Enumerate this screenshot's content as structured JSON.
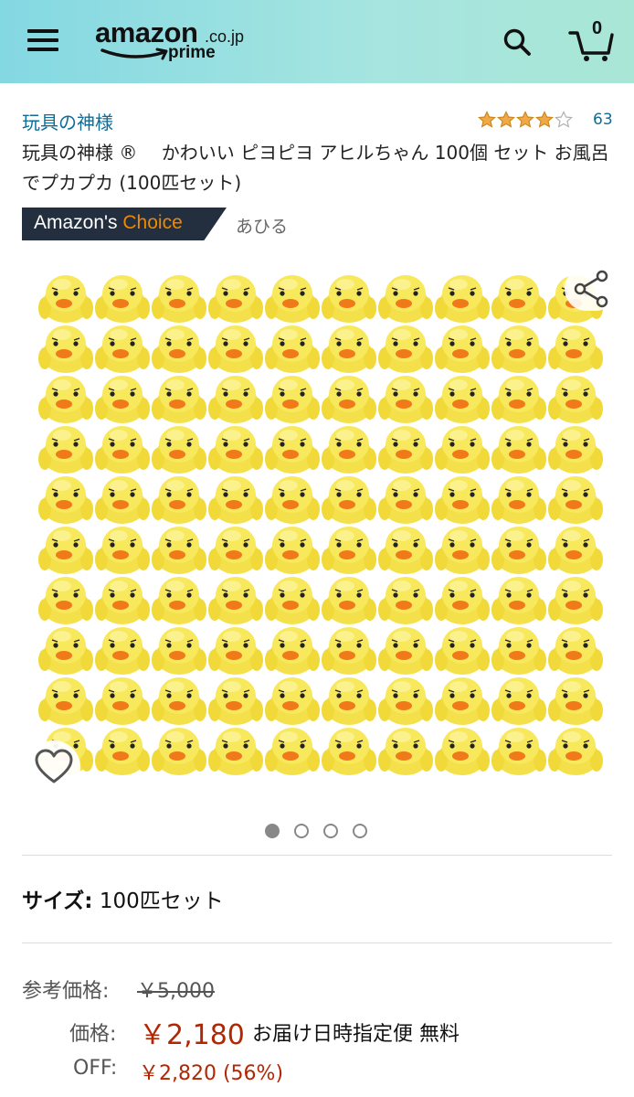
{
  "header": {
    "logo_word": "amazon",
    "logo_tld": ".co.jp",
    "logo_sub": "prime",
    "cart_count": "0",
    "colors": {
      "gradient_start": "#84d8e2",
      "gradient_end": "#a9e6d6"
    }
  },
  "product": {
    "brand": "玩具の神様",
    "rating": 4.0,
    "review_count": "63",
    "title": "玩具の神様 ®　 かわいい ピヨピヨ アヒルちゃん 100個 セット お風呂でプカプカ (100匹セット)",
    "badge_label": "Amazon's",
    "badge_choice": "Choice",
    "badge_keyword": "あひる",
    "image_count": 4,
    "active_image": 1
  },
  "size": {
    "label": "サイズ:",
    "value": "100匹セット"
  },
  "pricing": {
    "list_price_label": "参考価格:",
    "list_price": "￥5,000",
    "price_label": "価格:",
    "price": "￥2,180",
    "shipping": "お届け日時指定便 無料",
    "off_label": "OFF:",
    "off_value": "￥2,820 (56%)"
  },
  "colors": {
    "link": "#0f6c97",
    "price": "#b12704",
    "badge_bg": "#232f3e",
    "badge_accent": "#f08804",
    "star": "#f3a847"
  }
}
